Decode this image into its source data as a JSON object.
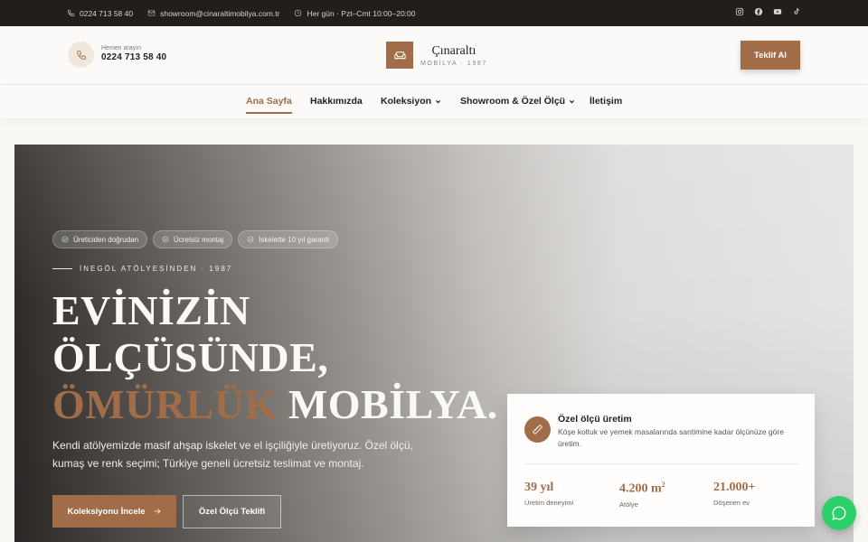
{
  "topbar": {
    "phone": "0224 713 58 40",
    "email": "showroom@cinaraltimobilya.com.tr",
    "hours": "Her gün · Pzt–Cmt 10:00–20:00",
    "social": [
      "instagram-icon",
      "facebook-icon",
      "youtube-icon",
      "tiktok-icon"
    ]
  },
  "header": {
    "call_label": "Hemen arayın",
    "call_number": "0224 713 58 40",
    "logo_name": "Çınaraltı",
    "logo_sub": "MOBİLYA · 1987",
    "cta": "Teklif Al"
  },
  "nav": {
    "items": [
      {
        "label": "Ana Sayfa",
        "active": true
      },
      {
        "label": "Hakkımızda",
        "active": false
      },
      {
        "label": "Koleksiyon",
        "active": false,
        "dropdown": true
      },
      {
        "label": "Showroom & Özel Ölçü",
        "active": false,
        "dropdown": true
      },
      {
        "label": "İletişim",
        "active": false
      }
    ]
  },
  "hero": {
    "badges": [
      "Üreticiden doğrudan",
      "Ücretsiz montaj",
      "İskelette 10 yıl garanti"
    ],
    "eyebrow": "İNEGÖL ATÖLYESİNDEN · 1987",
    "headline_1": "EVİNİZİN",
    "headline_2": "ÖLÇÜSÜNDE,",
    "headline_accent": "ÖMÜRLÜK",
    "headline_3": "MOBİLYA.",
    "lead": "Kendi atölyemizde masif ahşap iskelet ve el işçiliğiyle üretiyoruz. Özel ölçü, kumaş ve renk seçimi; Türkiye geneli ücretsiz teslimat ve montaj.",
    "primary_button": "Koleksiyonu İncele",
    "secondary_button": "Özel Ölçü Teklifi"
  },
  "card": {
    "title": "Özel ölçü üretim",
    "desc": "Köşe koltuk ve yemek masalarında santimine kadar ölçünüze göre üretim.",
    "stats": [
      {
        "value": "39 yıl",
        "label": "Üretim deneyimi"
      },
      {
        "value": "4.200 m",
        "sup": "2",
        "label": "Atölye"
      },
      {
        "value": "21.000+",
        "label": "Döşenen ev"
      }
    ]
  },
  "colors": {
    "accent": "#a06d48",
    "topbar_bg": "#211e1b",
    "whatsapp": "#2bd06a"
  }
}
